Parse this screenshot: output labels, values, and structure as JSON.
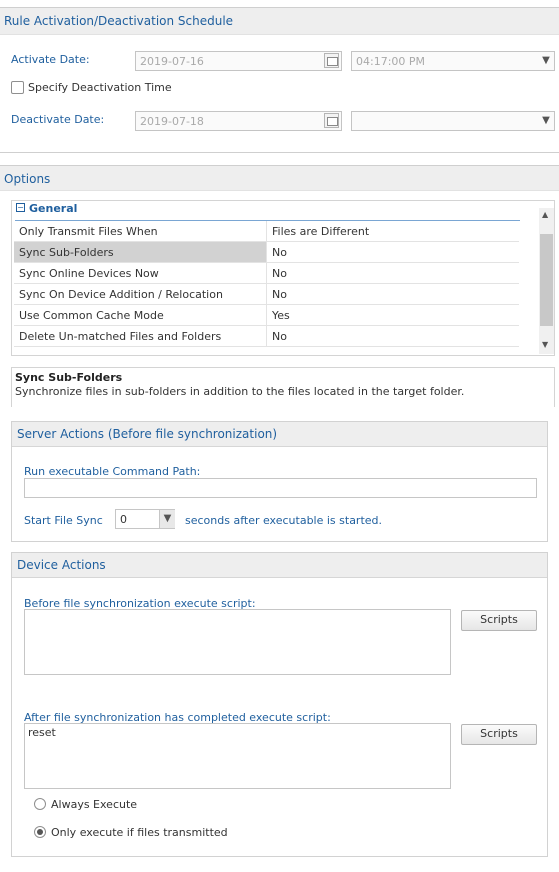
{
  "schedule": {
    "title": "Rule Activation/Deactivation Schedule",
    "activate_label": "Activate Date:",
    "activate_date": "2019-07-16",
    "activate_time": "04:17:00 PM",
    "deactivation_checkbox_label": "Specify Deactivation Time",
    "deactivation_checked": false,
    "deactivate_label": "Deactivate Date:",
    "deactivate_date": "2019-07-18",
    "deactivate_time": ""
  },
  "options": {
    "title": "Options",
    "group_label": "General",
    "group_toggle_icon": "collapse-icon",
    "rows": [
      {
        "key": "Only Transmit Files When",
        "value": "Files are Different"
      },
      {
        "key": "Sync Sub-Folders",
        "value": "No"
      },
      {
        "key": "Sync Online Devices Now",
        "value": "No"
      },
      {
        "key": "Sync On Device Addition / Relocation",
        "value": "No"
      },
      {
        "key": "Use Common Cache Mode",
        "value": "Yes"
      },
      {
        "key": "Delete Un-matched Files and Folders",
        "value": "No"
      }
    ],
    "selected_row": "Sync Sub-Folders",
    "description_title": "Sync Sub-Folders",
    "description_text": "Synchronize files in sub-folders in addition to the files located in the target folder."
  },
  "server_actions": {
    "title": "Server Actions (Before file synchronization)",
    "command_label": "Run executable Command Path:",
    "command_value": "",
    "start_label": "Start File Sync",
    "start_value": "0",
    "start_suffix": "seconds after executable is started."
  },
  "device_actions": {
    "title": "Device Actions",
    "before_label": "Before file synchronization execute script:",
    "before_script": "",
    "after_label": "After file synchronization has completed execute script:",
    "after_script": "reset",
    "scripts_button": "Scripts",
    "radio_always": "Always Execute",
    "radio_only": "Only execute if files transmitted",
    "selected_radio": "Only execute if files transmitted"
  },
  "colors": {
    "accent": "#1f5f9e",
    "header_bg": "#eeeeee",
    "selected_row": "#d2d2d2"
  }
}
